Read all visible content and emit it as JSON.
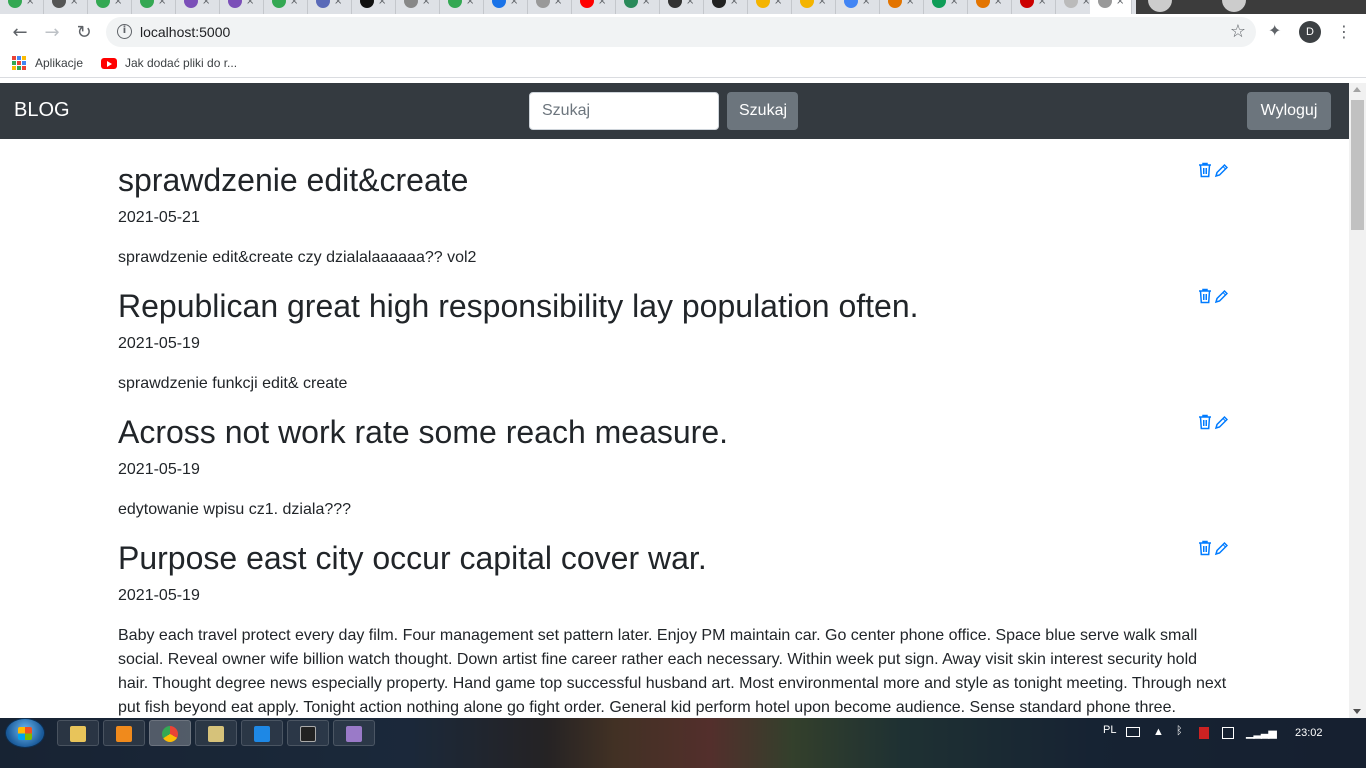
{
  "browser": {
    "url": "localhost:5000",
    "avatar_letter": "D",
    "bookmarks": [
      {
        "label": "Aplikacje",
        "icon": "apps-grid-icon"
      },
      {
        "label": "Jak dodać pliki do r...",
        "icon": "youtube-icon"
      }
    ]
  },
  "navbar": {
    "brand": "BLOG",
    "search_placeholder": "Szukaj",
    "search_button": "Szukaj",
    "logout_button": "Wyloguj"
  },
  "posts": [
    {
      "title": "sprawdzenie edit&create",
      "date": "2021-05-21",
      "body": "sprawdzenie edit&create czy dzialalaaaaaa?? vol2"
    },
    {
      "title": "Republican great high responsibility lay population often.",
      "date": "2021-05-19",
      "body": "sprawdzenie funkcji edit& create"
    },
    {
      "title": "Across not work rate some reach measure.",
      "date": "2021-05-19",
      "body": "edytowanie wpisu cz1. dziala???"
    },
    {
      "title": "Purpose east city occur capital cover war.",
      "date": "2021-05-19",
      "body": "Baby each travel protect every day film. Four management set pattern later. Enjoy PM maintain car. Go center phone office. Space blue serve walk small social. Reveal owner wife billion watch thought. Down artist fine career rather each necessary. Within week put sign. Away visit skin interest security hold hair. Thought degree news especially property. Hand game top successful husband art. Most environmental more and style as tonight meeting. Through next put fish beyond eat apply. Tonight action nothing alone go fight order. General kid perform hotel upon become audience. Sense standard phone three. Suggest"
    }
  ],
  "taskbar": {
    "language": "PL",
    "time": "23:02"
  },
  "colors": {
    "navbar_bg": "#343a40",
    "button_gray": "#6c757d",
    "action_icon_blue": "#007bff"
  }
}
